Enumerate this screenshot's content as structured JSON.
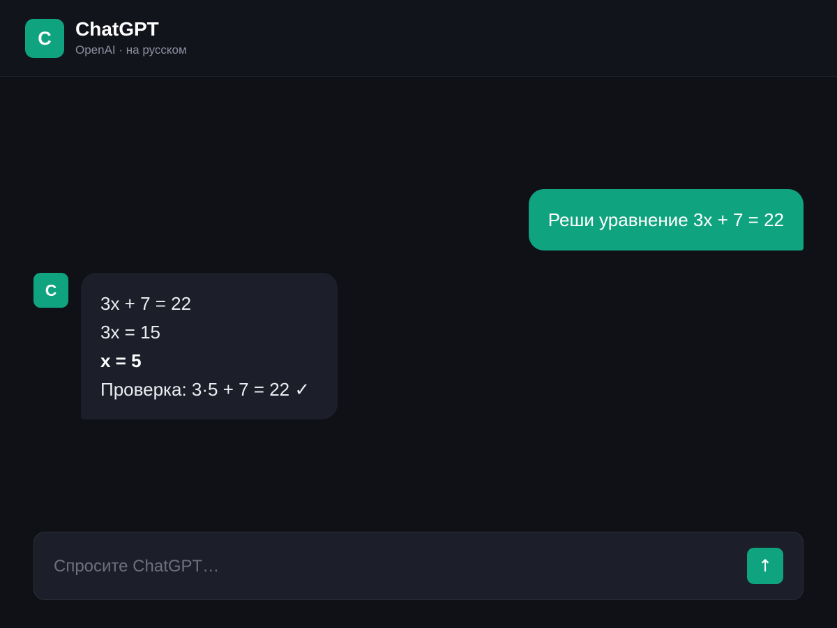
{
  "header": {
    "logo_letter": "C",
    "title": "ChatGPT",
    "subtitle": "OpenAI · на русском"
  },
  "messages": {
    "user": {
      "text": "Реши уравнение 3x + 7 = 22"
    },
    "assistant": {
      "avatar_letter": "C",
      "lines": [
        "3x + 7 = 22",
        "3x = 15",
        "x = 5",
        "Проверка: 3·5 + 7 = 22 ✓"
      ]
    }
  },
  "composer": {
    "placeholder": "Спросите ChatGPT…",
    "value": "",
    "send_icon": "arrow-up-icon",
    "send_glyph": "↑"
  },
  "colors": {
    "accent": "#10a37f",
    "background": "#101116",
    "header_background": "#12141b",
    "bubble_background": "#1c1e29"
  }
}
